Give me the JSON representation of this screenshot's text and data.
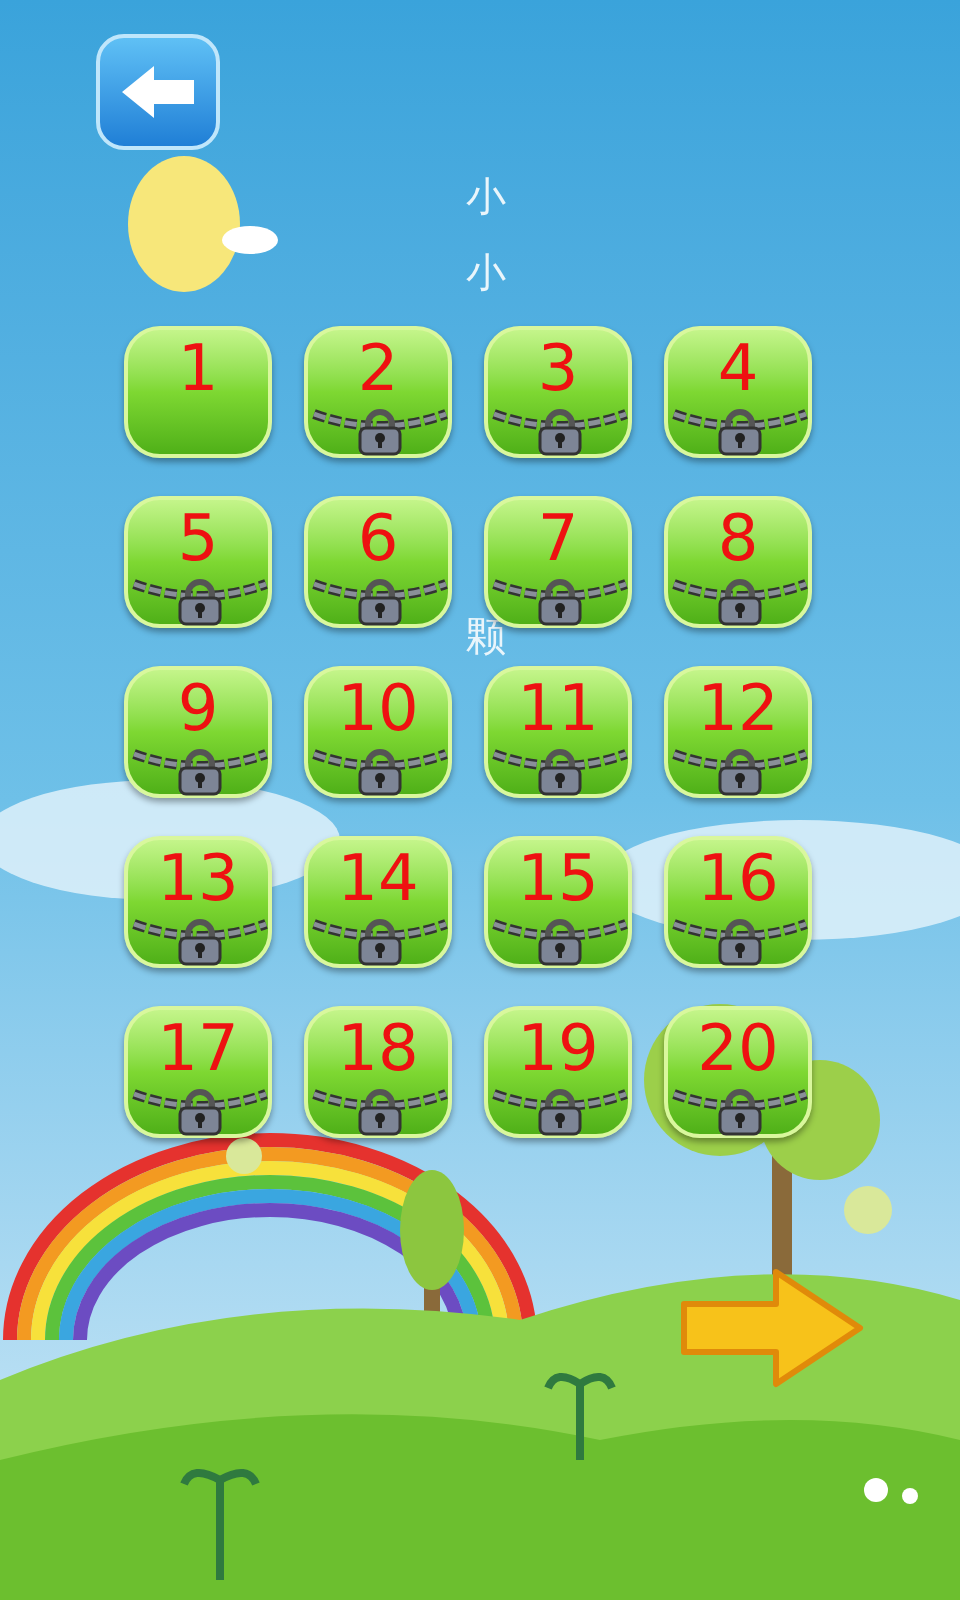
{
  "background_text": [
    "小",
    "小",
    "颗"
  ],
  "levels": [
    {
      "label": "1",
      "locked": false
    },
    {
      "label": "2",
      "locked": true
    },
    {
      "label": "3",
      "locked": true
    },
    {
      "label": "4",
      "locked": true
    },
    {
      "label": "5",
      "locked": true
    },
    {
      "label": "6",
      "locked": true
    },
    {
      "label": "7",
      "locked": true
    },
    {
      "label": "8",
      "locked": true
    },
    {
      "label": "9",
      "locked": true
    },
    {
      "label": "10",
      "locked": true
    },
    {
      "label": "11",
      "locked": true
    },
    {
      "label": "12",
      "locked": true
    },
    {
      "label": "13",
      "locked": true
    },
    {
      "label": "14",
      "locked": true
    },
    {
      "label": "15",
      "locked": true
    },
    {
      "label": "16",
      "locked": true
    },
    {
      "label": "17",
      "locked": true
    },
    {
      "label": "18",
      "locked": true
    },
    {
      "label": "19",
      "locked": true
    },
    {
      "label": "20",
      "locked": true
    }
  ]
}
